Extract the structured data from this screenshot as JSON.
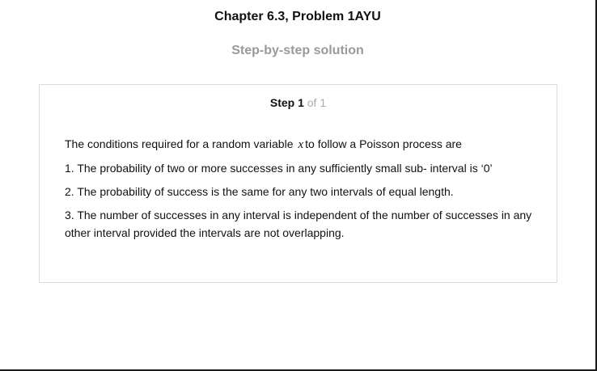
{
  "header": {
    "title": "Chapter 6.3, Problem 1AYU",
    "subtitle": "Step-by-step solution"
  },
  "step": {
    "label": "Step 1",
    "of_text": "of 1"
  },
  "content": {
    "intro_before": "The conditions required for a random variable",
    "intro_variable": "x",
    "intro_after": "to follow a Poisson process are",
    "items": [
      "1. The probability of two or more successes in any sufficiently small sub- interval is ‘0’",
      "2. The probability of success is the same for any two intervals of equal length.",
      "3. The number of successes in any interval is independent of the number of successes in any other interval provided the intervals are not overlapping."
    ]
  }
}
